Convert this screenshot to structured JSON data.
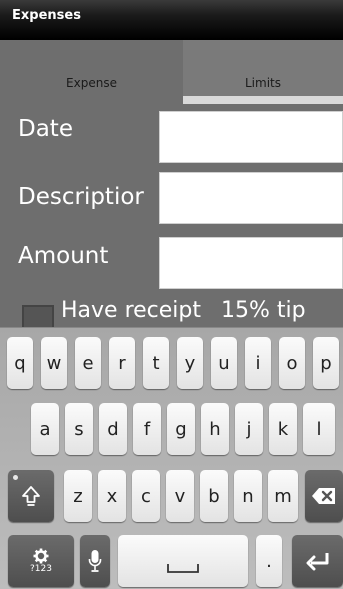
{
  "app": {
    "title": "Expenses"
  },
  "tabs": [
    {
      "label": "Expense"
    },
    {
      "label": "Limits"
    }
  ],
  "form": {
    "date_label": "Date",
    "date_value": "",
    "description_label": "Descriptior",
    "description_value": "",
    "amount_label": "Amount",
    "amount_value": "",
    "receipt_label": "Have receipt",
    "tip_label": "15% tip"
  },
  "keyboard": {
    "row1": [
      "q",
      "w",
      "e",
      "r",
      "t",
      "y",
      "u",
      "i",
      "o",
      "p"
    ],
    "row2": [
      "a",
      "s",
      "d",
      "f",
      "g",
      "h",
      "j",
      "k",
      "l"
    ],
    "row3": [
      "z",
      "x",
      "c",
      "v",
      "b",
      "n",
      "m"
    ],
    "symbols_label": "?123",
    "period_label": ".",
    "icons": {
      "shift": "shift-icon",
      "backspace": "backspace-icon",
      "settings": "gear-icon",
      "mic": "microphone-icon",
      "space": "space-icon",
      "enter": "enter-icon"
    }
  },
  "colors": {
    "background": "#6e6e6e",
    "title_bar": "#000000",
    "keyboard": "#b3b3b3",
    "key": "#f2f2f2",
    "dark_key": "#5a5a5a"
  }
}
